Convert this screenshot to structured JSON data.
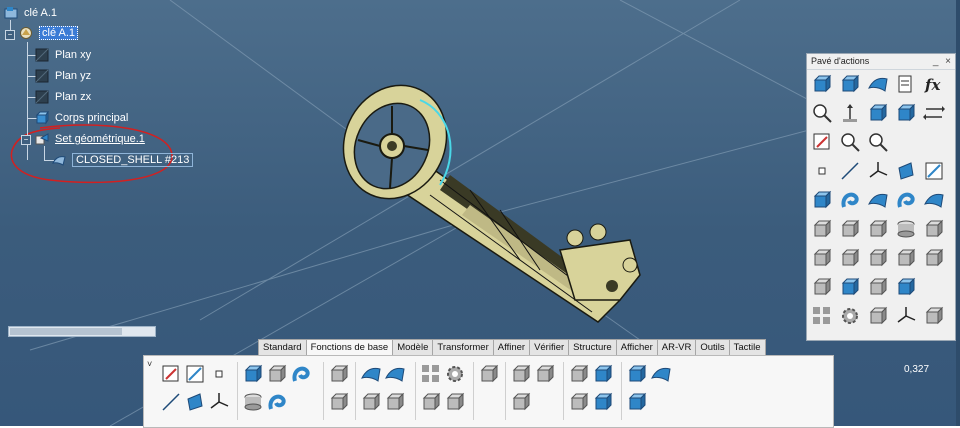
{
  "tree": {
    "root_label": "clé A.1",
    "part_label": "clé A.1",
    "items": [
      {
        "label": "Plan xy",
        "icon": "plane-icon"
      },
      {
        "label": "Plan yz",
        "icon": "plane-icon"
      },
      {
        "label": "Plan zx",
        "icon": "plane-icon"
      },
      {
        "label": "Corps principal",
        "icon": "body-icon"
      },
      {
        "label": "Set géométrique.1",
        "icon": "geometrical-set-icon"
      },
      {
        "label": "CLOSED_SHELL #213",
        "icon": "surface-icon"
      }
    ]
  },
  "actions_panel": {
    "title": "Pavé d'actions",
    "minimize": "_",
    "close": "×",
    "formula_label": "fx"
  },
  "tabs": [
    "Standard",
    "Fonctions de base",
    "Modèle",
    "Transformer",
    "Affiner",
    "Vérifier",
    "Structure",
    "Afficher",
    "AR-VR",
    "Outils",
    "Tactile"
  ],
  "active_tab": "Fonctions de base",
  "ribbon": {
    "collapse": "˅"
  },
  "status": {
    "zoom_value": "0,327"
  },
  "colors": {
    "viewport": "#3f6282",
    "model_fill": "#e0dca8",
    "model_edge": "#1a1a10",
    "annotation_ring": "#d32020",
    "icon_blue": "#2f86c8",
    "icon_grey": "#9a9a9a"
  }
}
